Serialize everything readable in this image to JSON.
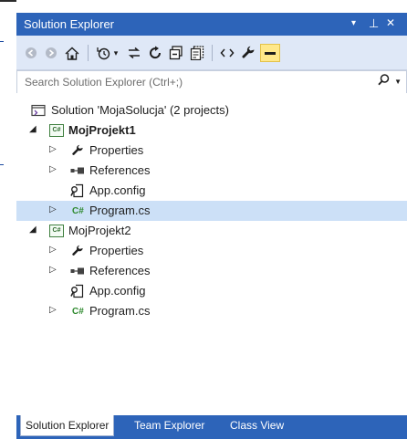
{
  "window": {
    "title": "Solution Explorer",
    "dropdown_glyph": "▾",
    "pin_glyph": "⊥",
    "close_glyph": "✕"
  },
  "toolbar": {
    "icons": [
      "back-icon",
      "forward-icon",
      "home-icon",
      "history-icon",
      "dropdown-icon",
      "sync-icon",
      "refresh-icon",
      "collapse-all-icon",
      "show-all-files-icon",
      "view-code-icon",
      "properties-icon",
      "preview-icon"
    ]
  },
  "search": {
    "placeholder": "Search Solution Explorer (Ctrl+;)"
  },
  "tree": {
    "solution": "Solution 'MojaSolucja' (2 projects)",
    "project1": {
      "name": "MojProjekt1",
      "properties": "Properties",
      "references": "References",
      "appconfig": "App.config",
      "program": "Program.cs"
    },
    "project2": {
      "name": "MojProjekt2",
      "properties": "Properties",
      "references": "References",
      "appconfig": "App.config",
      "program": "Program.cs"
    },
    "project_icon_text": "C#",
    "cs_icon_text": "C#"
  },
  "bottom_tabs": {
    "solution_explorer": "Solution Explorer",
    "team_explorer": "Team Explorer",
    "class_view": "Class View"
  },
  "colors": {
    "accent": "#2d64b9",
    "toolbar_bg": "#dfe8f7",
    "selection": "#cce0f7"
  }
}
